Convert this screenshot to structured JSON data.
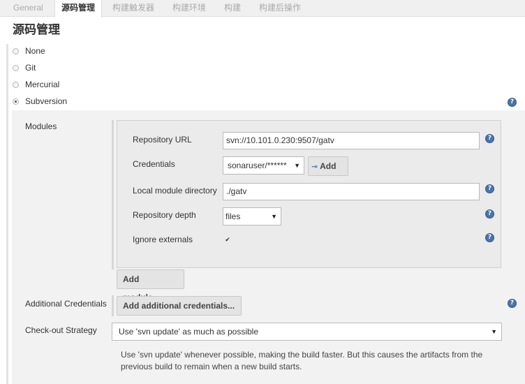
{
  "tabs": [
    {
      "label": "General"
    },
    {
      "label": "源码管理"
    },
    {
      "label": "构建触发器"
    },
    {
      "label": "构建环境"
    },
    {
      "label": "构建"
    },
    {
      "label": "构建后操作"
    }
  ],
  "section_title": "源码管理",
  "scm_options": [
    {
      "label": "None",
      "selected": false
    },
    {
      "label": "Git",
      "selected": false
    },
    {
      "label": "Mercurial",
      "selected": false
    },
    {
      "label": "Subversion",
      "selected": true
    }
  ],
  "modules": {
    "label": "Modules",
    "repository_url": {
      "label": "Repository URL",
      "value": "svn://10.101.0.230:9507/gatv"
    },
    "credentials": {
      "label": "Credentials",
      "value": "sonaruser/******",
      "add_label": "Add"
    },
    "local_module_directory": {
      "label": "Local module directory",
      "value": "./gatv"
    },
    "repository_depth": {
      "label": "Repository depth",
      "value": "files"
    },
    "ignore_externals": {
      "label": "Ignore externals",
      "checked": true
    },
    "add_module_label": "Add module..."
  },
  "additional_credentials": {
    "label": "Additional Credentials",
    "button_label": "Add additional credentials..."
  },
  "checkout_strategy": {
    "label": "Check-out Strategy",
    "value": "Use 'svn update' as much as possible",
    "description": "Use 'svn update' whenever possible, making the build faster. But this causes the artifacts from the previous build to remain when a new build starts."
  },
  "help_glyph": "?",
  "colors": {
    "accent": "#4a74a8",
    "panel": "#f2f2f2",
    "tabbar": "#f0f0f0"
  }
}
